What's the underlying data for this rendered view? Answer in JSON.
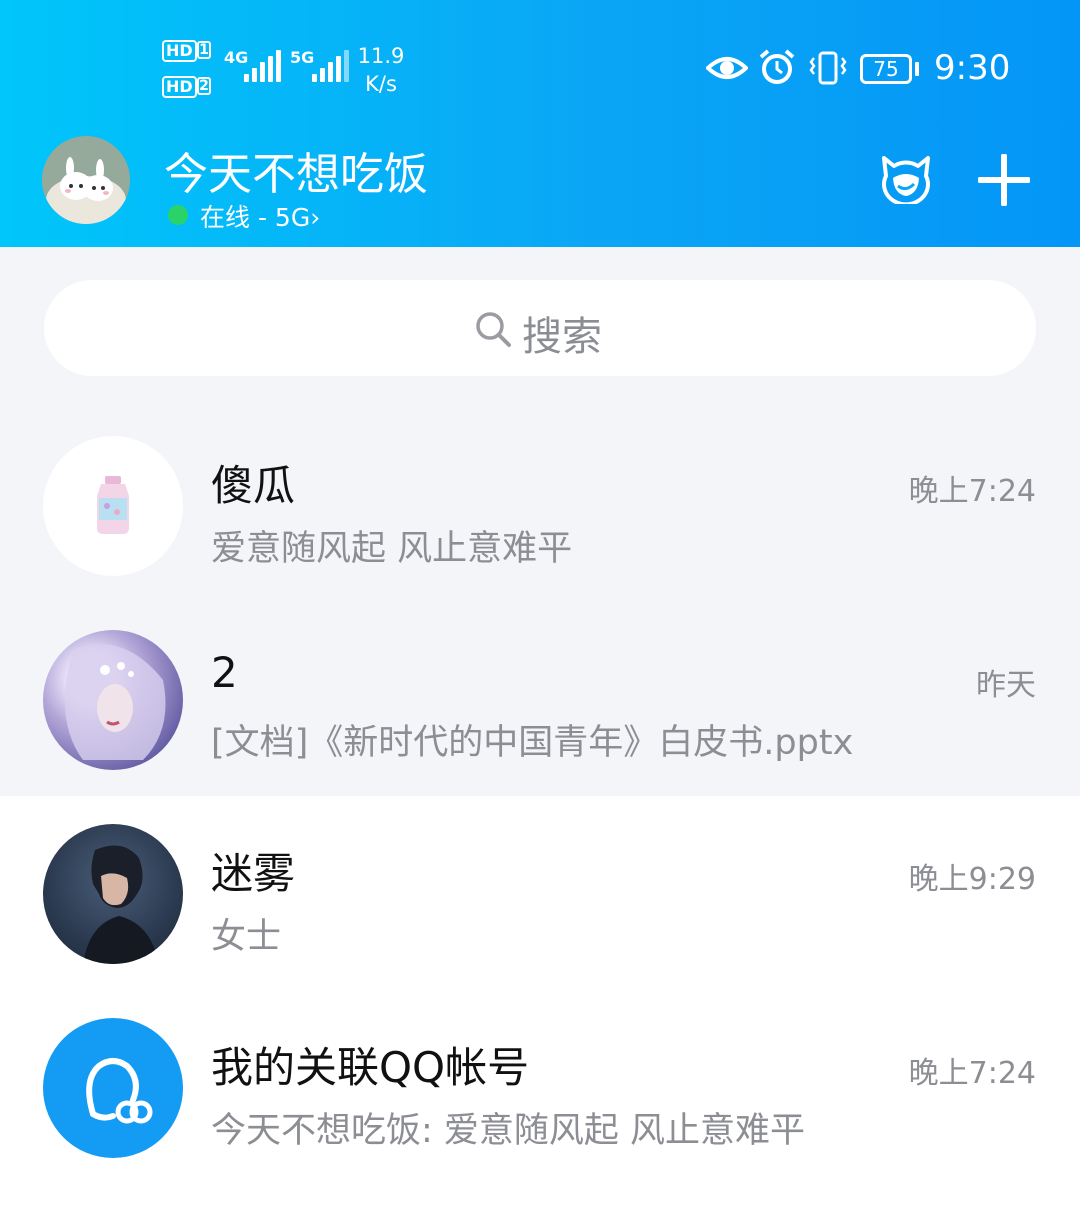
{
  "status_bar": {
    "hd1": "HD",
    "sim1": "1",
    "hd2": "HD",
    "sim2": "2",
    "net1": "4G",
    "net2": "5G",
    "speed_value": "11.9",
    "speed_unit": "K/s",
    "battery": "75",
    "time": "9:30"
  },
  "header": {
    "username": "今天不想吃饭",
    "status": "在线 - 5G",
    "status_chevron": "›",
    "accent_color": "#0aa6f5",
    "online_color": "#29d36a"
  },
  "search": {
    "placeholder": "搜索"
  },
  "chats": [
    {
      "name": "傻瓜",
      "message": "爱意随风起 风止意难平",
      "time": "晚上7:24",
      "pinned": true,
      "avatar": "bottle-avatar"
    },
    {
      "name": "2",
      "message": "[文档]《新时代的中国青年》白皮书.pptx",
      "time": "昨天",
      "pinned": true,
      "avatar": "anime-girl-avatar"
    },
    {
      "name": "迷雾",
      "message": "女士",
      "time": "晚上9:29",
      "pinned": false,
      "avatar": "man-portrait-avatar"
    },
    {
      "name": "我的关联QQ帐号",
      "message": "今天不想吃饭: 爱意随风起 风止意难平",
      "time": "晚上7:24",
      "pinned": false,
      "avatar": "linked-account-avatar"
    }
  ]
}
